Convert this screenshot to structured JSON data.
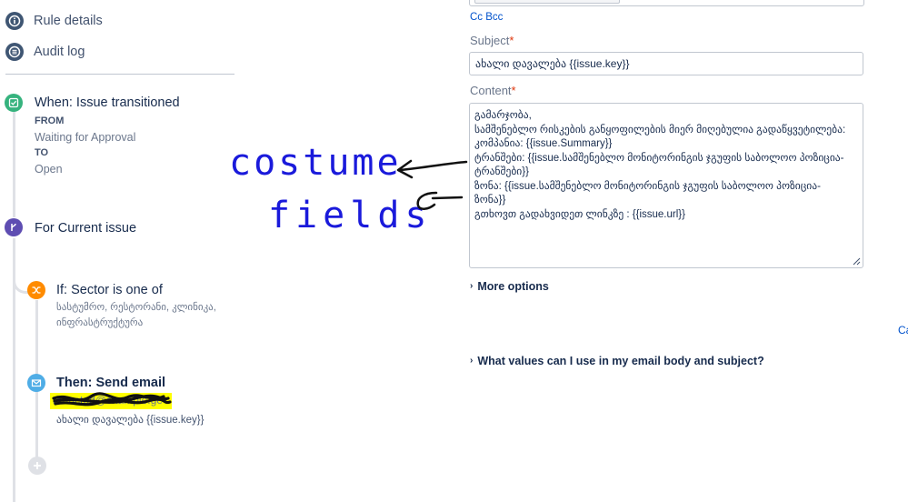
{
  "sidebar": {
    "rule_details": "Rule details",
    "audit_log": "Audit log"
  },
  "flow": {
    "trigger": {
      "title": "When: Issue transitioned",
      "from_label": "FROM",
      "from_value": "Waiting for Approval",
      "to_label": "TO",
      "to_value": "Open"
    },
    "branch": {
      "title": "For Current issue"
    },
    "condition": {
      "title": "If: Sector is one of",
      "values": "სასტუმრო, რესტორანი, კლინიკა, ინფრასტრუქტურა"
    },
    "action": {
      "title": "Then: Send email",
      "recipient": "redacted@example.ge",
      "subject": "ახალი დავალება {{issue.key}}"
    }
  },
  "email_form": {
    "cc_bcc": "Cc Bcc",
    "subject_label": "Subject",
    "subject_value": "ახალი დავალება {{issue.key}}",
    "content_label": "Content",
    "content_lines": [
      "გამარჯობა,",
      "სამშენებლო რისკების განყოფილების მიერ მიღებულია გადაწყვეტილება:",
      "კომპანია: {{issue.Summary}}",
      "ტრანშები: {{issue.სამშენებლო მონიტორინგის ჯგუფის საბოლოო პოზიცია-",
      "ტრანშები}}",
      "ზონა: {{issue.სამშენებლო მონიტორინგის ჯგუფის საბოლოო პოზიცია-",
      "ზონა}}",
      "გთხოვთ გადახვიდეთ ლინკზე : {{issue.url}}"
    ],
    "more_options": "More options",
    "values_help": "What values can I use in my email body and subject?",
    "cut_link": "Ca"
  },
  "annotation": {
    "line1": "costume",
    "line2": "fields",
    "ink_color": "#1a1adb",
    "highlight_color": "#ffff00"
  }
}
